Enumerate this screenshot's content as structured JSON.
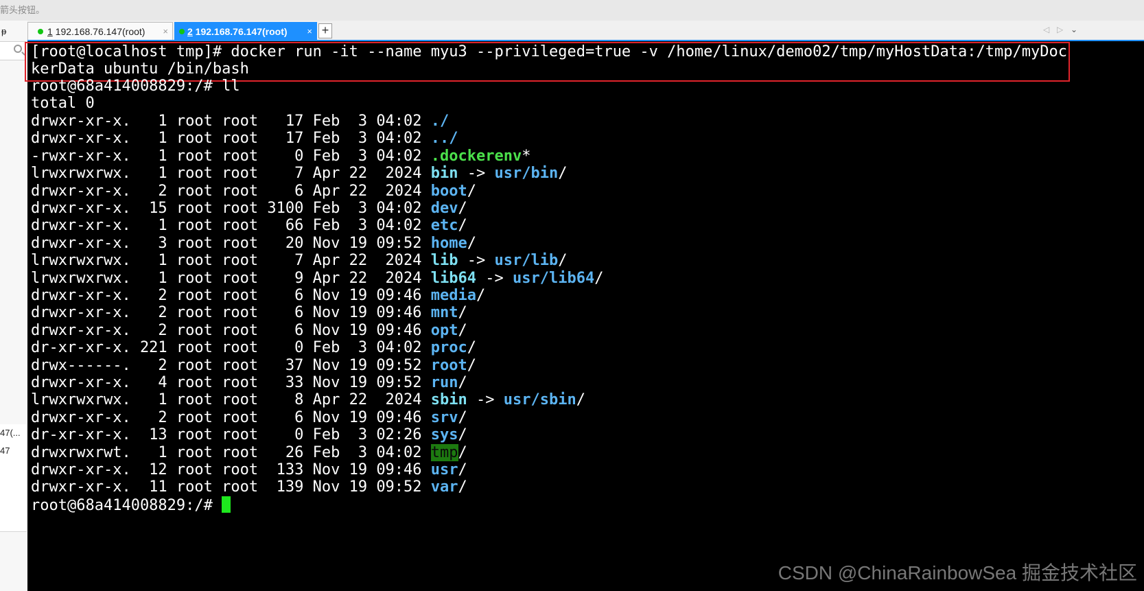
{
  "top_hint": "箭头按钮。",
  "tabs": [
    {
      "number": "1",
      "label": " 192.168.76.147(root)",
      "close": "×",
      "active": false
    },
    {
      "number": "2",
      "label": " 192.168.76.147(root)",
      "close": "×",
      "active": true
    }
  ],
  "tab_add": "+",
  "nav": {
    "prev": "◁",
    "next": "▷",
    "menu": "⌄"
  },
  "left_panel": {
    "pin": "ᵽ",
    "rows": [
      "47(...",
      "47",
      "",
      "",
      "",
      ""
    ]
  },
  "terminal": {
    "cmd_line1": "[root@localhost tmp]# docker run -it --name myu3 --privileged=true -v /home/linux/demo02/tmp/myHostData:/tmp/myDoc",
    "cmd_line2": "kerData ubuntu /bin/bash",
    "prompt": "root@68a414008829:/# ",
    "ll_cmd": "ll",
    "total": "total 0",
    "entries": [
      {
        "meta": "drwxr-xr-x.   1 root root   17 Feb  3 04:02 ",
        "name": "./",
        "type": "dir"
      },
      {
        "meta": "drwxr-xr-x.   1 root root   17 Feb  3 04:02 ",
        "name": "../",
        "type": "dir"
      },
      {
        "meta": "-rwxr-xr-x.   1 root root    0 Feb  3 04:02 ",
        "name": ".dockerenv",
        "suffix": "*",
        "type": "exec"
      },
      {
        "meta": "lrwxrwxrwx.   1 root root    7 Apr 22  2024 ",
        "name": "bin",
        "arrow": " -> ",
        "target": "usr/bin",
        "suffix": "/",
        "type": "link"
      },
      {
        "meta": "drwxr-xr-x.   2 root root    6 Apr 22  2024 ",
        "name": "boot",
        "suffix": "/",
        "type": "dir"
      },
      {
        "meta": "drwxr-xr-x.  15 root root 3100 Feb  3 04:02 ",
        "name": "dev",
        "suffix": "/",
        "type": "dir"
      },
      {
        "meta": "drwxr-xr-x.   1 root root   66 Feb  3 04:02 ",
        "name": "etc",
        "suffix": "/",
        "type": "dir"
      },
      {
        "meta": "drwxr-xr-x.   3 root root   20 Nov 19 09:52 ",
        "name": "home",
        "suffix": "/",
        "type": "dir"
      },
      {
        "meta": "lrwxrwxrwx.   1 root root    7 Apr 22  2024 ",
        "name": "lib",
        "arrow": " -> ",
        "target": "usr/lib",
        "suffix": "/",
        "type": "link"
      },
      {
        "meta": "lrwxrwxrwx.   1 root root    9 Apr 22  2024 ",
        "name": "lib64",
        "arrow": " -> ",
        "target": "usr/lib64",
        "suffix": "/",
        "type": "link"
      },
      {
        "meta": "drwxr-xr-x.   2 root root    6 Nov 19 09:46 ",
        "name": "media",
        "suffix": "/",
        "type": "dir"
      },
      {
        "meta": "drwxr-xr-x.   2 root root    6 Nov 19 09:46 ",
        "name": "mnt",
        "suffix": "/",
        "type": "dir"
      },
      {
        "meta": "drwxr-xr-x.   2 root root    6 Nov 19 09:46 ",
        "name": "opt",
        "suffix": "/",
        "type": "dir"
      },
      {
        "meta": "dr-xr-xr-x. 221 root root    0 Feb  3 04:02 ",
        "name": "proc",
        "suffix": "/",
        "type": "dir"
      },
      {
        "meta": "drwx------.   2 root root   37 Nov 19 09:52 ",
        "name": "root",
        "suffix": "/",
        "type": "dir"
      },
      {
        "meta": "drwxr-xr-x.   4 root root   33 Nov 19 09:52 ",
        "name": "run",
        "suffix": "/",
        "type": "dir"
      },
      {
        "meta": "lrwxrwxrwx.   1 root root    8 Apr 22  2024 ",
        "name": "sbin",
        "arrow": " -> ",
        "target": "usr/sbin",
        "suffix": "/",
        "type": "link"
      },
      {
        "meta": "drwxr-xr-x.   2 root root    6 Nov 19 09:46 ",
        "name": "srv",
        "suffix": "/",
        "type": "dir"
      },
      {
        "meta": "dr-xr-xr-x.  13 root root    0 Feb  3 02:26 ",
        "name": "sys",
        "suffix": "/",
        "type": "dir"
      },
      {
        "meta": "drwxrwxrwt.   1 root root   26 Feb  3 04:02 ",
        "name": "tmp",
        "suffix": "/",
        "type": "sticky"
      },
      {
        "meta": "drwxr-xr-x.  12 root root  133 Nov 19 09:46 ",
        "name": "usr",
        "suffix": "/",
        "type": "dir"
      },
      {
        "meta": "drwxr-xr-x.  11 root root  139 Nov 19 09:52 ",
        "name": "var",
        "suffix": "/",
        "type": "dir"
      }
    ]
  },
  "watermark": "CSDN @ChinaRainbowSea 掘金技术社区",
  "colors": {
    "dir": "#5cb4f2",
    "link": "#7ee0f2",
    "exec": "#4be04b",
    "sticky_bg": "#1d7a10",
    "highlight_box": "#e0242b",
    "tab_active": "#1e90ff",
    "cursor": "#1ee81e"
  }
}
